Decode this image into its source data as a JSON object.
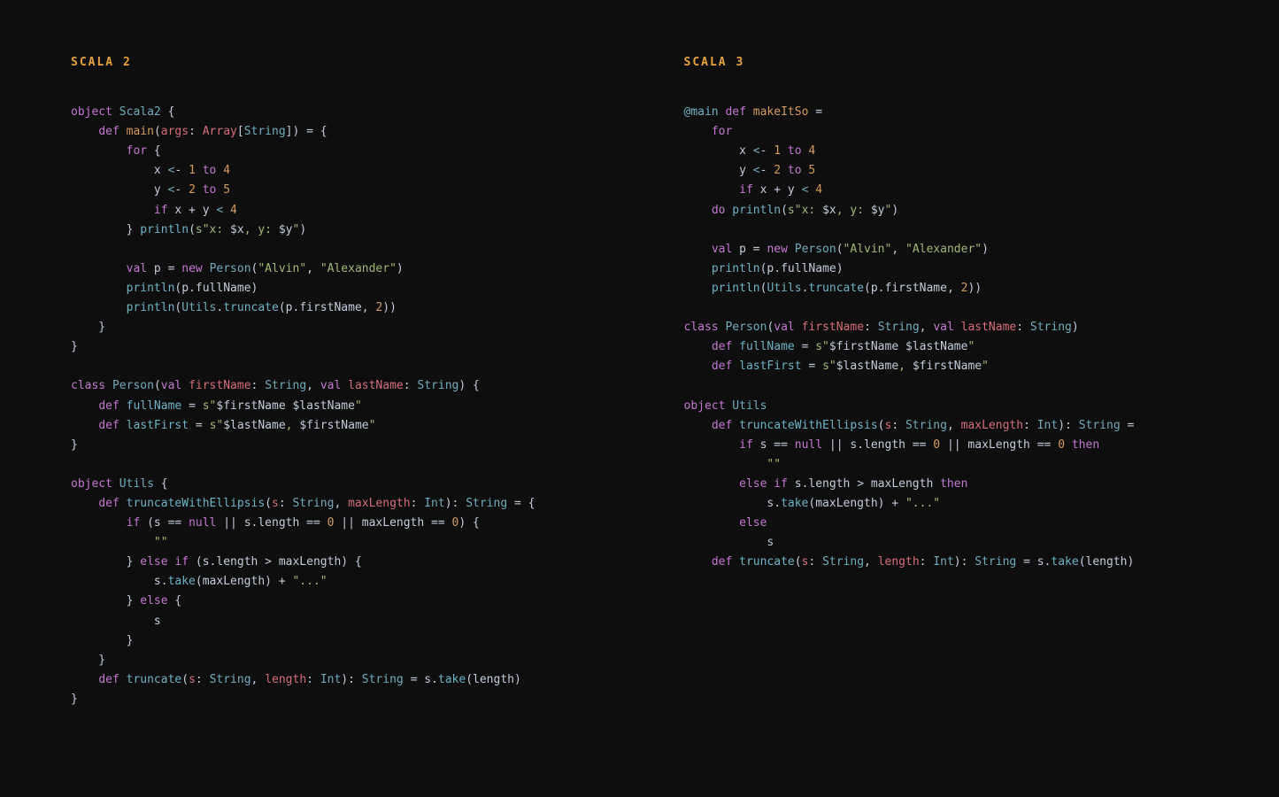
{
  "left": {
    "title": "SCALA 2",
    "lines": [
      [
        [
          "kw",
          "object"
        ],
        [
          "pl",
          " "
        ],
        [
          "ty",
          "Scala2"
        ],
        [
          "pl",
          " {"
        ]
      ],
      [
        [
          "pl",
          "    "
        ],
        [
          "kw",
          "def"
        ],
        [
          "pl",
          " "
        ],
        [
          "name",
          "main"
        ],
        [
          "pl",
          "("
        ],
        [
          "id",
          "args"
        ],
        [
          "pl",
          ": "
        ],
        [
          "id",
          "Array"
        ],
        [
          "pl",
          "["
        ],
        [
          "ty",
          "String"
        ],
        [
          "pl",
          "]) = {"
        ]
      ],
      [
        [
          "pl",
          "        "
        ],
        [
          "kw",
          "for"
        ],
        [
          "pl",
          " {"
        ]
      ],
      [
        [
          "pl",
          "            x "
        ],
        [
          "op",
          "<"
        ],
        [
          "pl",
          "- "
        ],
        [
          "num",
          "1"
        ],
        [
          "pl",
          " "
        ],
        [
          "kw",
          "to"
        ],
        [
          "pl",
          " "
        ],
        [
          "num",
          "4"
        ]
      ],
      [
        [
          "pl",
          "            y "
        ],
        [
          "op",
          "<"
        ],
        [
          "pl",
          "- "
        ],
        [
          "num",
          "2"
        ],
        [
          "pl",
          " "
        ],
        [
          "kw",
          "to"
        ],
        [
          "pl",
          " "
        ],
        [
          "num",
          "5"
        ]
      ],
      [
        [
          "pl",
          "            "
        ],
        [
          "kw",
          "if"
        ],
        [
          "pl",
          " x + y "
        ],
        [
          "op",
          "<"
        ],
        [
          "pl",
          " "
        ],
        [
          "num",
          "4"
        ]
      ],
      [
        [
          "pl",
          "        } "
        ],
        [
          "fn",
          "println"
        ],
        [
          "pl",
          "("
        ],
        [
          "str",
          "s\"x: "
        ],
        [
          "pl",
          "$x"
        ],
        [
          "str",
          ", y: "
        ],
        [
          "pl",
          "$y"
        ],
        [
          "str",
          "\""
        ],
        [
          "pl",
          ")"
        ]
      ],
      [
        [
          "pl",
          ""
        ]
      ],
      [
        [
          "pl",
          "        "
        ],
        [
          "kw",
          "val"
        ],
        [
          "pl",
          " p = "
        ],
        [
          "kw",
          "new"
        ],
        [
          "pl",
          " "
        ],
        [
          "ty",
          "Person"
        ],
        [
          "pl",
          "("
        ],
        [
          "str",
          "\"Alvin\""
        ],
        [
          "pl",
          ", "
        ],
        [
          "str",
          "\"Alexander\""
        ],
        [
          "pl",
          ")"
        ]
      ],
      [
        [
          "pl",
          "        "
        ],
        [
          "fn",
          "println"
        ],
        [
          "pl",
          "(p.fullName)"
        ]
      ],
      [
        [
          "pl",
          "        "
        ],
        [
          "fn",
          "println"
        ],
        [
          "pl",
          "("
        ],
        [
          "ty",
          "Utils"
        ],
        [
          "pl",
          "."
        ],
        [
          "fn",
          "truncate"
        ],
        [
          "pl",
          "(p.firstName, "
        ],
        [
          "num",
          "2"
        ],
        [
          "pl",
          "))"
        ]
      ],
      [
        [
          "pl",
          "    }"
        ]
      ],
      [
        [
          "pl",
          "}"
        ]
      ],
      [
        [
          "pl",
          ""
        ]
      ],
      [
        [
          "kw",
          "class"
        ],
        [
          "pl",
          " "
        ],
        [
          "ty",
          "Person"
        ],
        [
          "pl",
          "("
        ],
        [
          "kw",
          "val"
        ],
        [
          "pl",
          " "
        ],
        [
          "id",
          "firstName"
        ],
        [
          "pl",
          ": "
        ],
        [
          "ty",
          "String"
        ],
        [
          "pl",
          ", "
        ],
        [
          "kw",
          "val"
        ],
        [
          "pl",
          " "
        ],
        [
          "id",
          "lastName"
        ],
        [
          "pl",
          ": "
        ],
        [
          "ty",
          "String"
        ],
        [
          "pl",
          ") {"
        ]
      ],
      [
        [
          "pl",
          "    "
        ],
        [
          "kw",
          "def"
        ],
        [
          "pl",
          " "
        ],
        [
          "fn",
          "fullName"
        ],
        [
          "pl",
          " = "
        ],
        [
          "str",
          "s\""
        ],
        [
          "pl",
          "$firstName $lastName"
        ],
        [
          "str",
          "\""
        ]
      ],
      [
        [
          "pl",
          "    "
        ],
        [
          "kw",
          "def"
        ],
        [
          "pl",
          " "
        ],
        [
          "fn",
          "lastFirst"
        ],
        [
          "pl",
          " = "
        ],
        [
          "str",
          "s\""
        ],
        [
          "pl",
          "$lastName"
        ],
        [
          "str",
          ", "
        ],
        [
          "pl",
          "$firstName"
        ],
        [
          "str",
          "\""
        ]
      ],
      [
        [
          "pl",
          "}"
        ]
      ],
      [
        [
          "pl",
          ""
        ]
      ],
      [
        [
          "kw",
          "object"
        ],
        [
          "pl",
          " "
        ],
        [
          "ty",
          "Utils"
        ],
        [
          "pl",
          " {"
        ]
      ],
      [
        [
          "pl",
          "    "
        ],
        [
          "kw",
          "def"
        ],
        [
          "pl",
          " "
        ],
        [
          "fn",
          "truncateWithEllipsis"
        ],
        [
          "pl",
          "("
        ],
        [
          "id",
          "s"
        ],
        [
          "pl",
          ": "
        ],
        [
          "ty",
          "String"
        ],
        [
          "pl",
          ", "
        ],
        [
          "id",
          "maxLength"
        ],
        [
          "pl",
          ": "
        ],
        [
          "ty",
          "Int"
        ],
        [
          "pl",
          "): "
        ],
        [
          "ty",
          "String"
        ],
        [
          "pl",
          " = {"
        ]
      ],
      [
        [
          "pl",
          "        "
        ],
        [
          "kw",
          "if"
        ],
        [
          "pl",
          " (s == "
        ],
        [
          "kw",
          "null"
        ],
        [
          "pl",
          " || s.length == "
        ],
        [
          "num",
          "0"
        ],
        [
          "pl",
          " || maxLength == "
        ],
        [
          "num",
          "0"
        ],
        [
          "pl",
          ") {"
        ]
      ],
      [
        [
          "pl",
          "            "
        ],
        [
          "str",
          "\"\""
        ]
      ],
      [
        [
          "pl",
          "        } "
        ],
        [
          "kw",
          "else"
        ],
        [
          "pl",
          " "
        ],
        [
          "kw",
          "if"
        ],
        [
          "pl",
          " (s.length > maxLength) {"
        ]
      ],
      [
        [
          "pl",
          "            s."
        ],
        [
          "fn",
          "take"
        ],
        [
          "pl",
          "(maxLength) + "
        ],
        [
          "str",
          "\"...\""
        ]
      ],
      [
        [
          "pl",
          "        } "
        ],
        [
          "kw",
          "else"
        ],
        [
          "pl",
          " {"
        ]
      ],
      [
        [
          "pl",
          "            s"
        ]
      ],
      [
        [
          "pl",
          "        }"
        ]
      ],
      [
        [
          "pl",
          "    }"
        ]
      ],
      [
        [
          "pl",
          "    "
        ],
        [
          "kw",
          "def"
        ],
        [
          "pl",
          " "
        ],
        [
          "fn",
          "truncate"
        ],
        [
          "pl",
          "("
        ],
        [
          "id",
          "s"
        ],
        [
          "pl",
          ": "
        ],
        [
          "ty",
          "String"
        ],
        [
          "pl",
          ", "
        ],
        [
          "id",
          "length"
        ],
        [
          "pl",
          ": "
        ],
        [
          "ty",
          "Int"
        ],
        [
          "pl",
          "): "
        ],
        [
          "ty",
          "String"
        ],
        [
          "pl",
          " = s."
        ],
        [
          "fn",
          "take"
        ],
        [
          "pl",
          "(length)"
        ]
      ],
      [
        [
          "pl",
          "}"
        ]
      ]
    ]
  },
  "right": {
    "title": "SCALA 3",
    "lines": [
      [
        [
          "fn",
          "@main"
        ],
        [
          "pl",
          " "
        ],
        [
          "kw",
          "def"
        ],
        [
          "pl",
          " "
        ],
        [
          "name",
          "makeItSo"
        ],
        [
          "pl",
          " ="
        ]
      ],
      [
        [
          "pl",
          "    "
        ],
        [
          "kw",
          "for"
        ]
      ],
      [
        [
          "pl",
          "        x "
        ],
        [
          "op",
          "<"
        ],
        [
          "pl",
          "- "
        ],
        [
          "num",
          "1"
        ],
        [
          "pl",
          " "
        ],
        [
          "kw",
          "to"
        ],
        [
          "pl",
          " "
        ],
        [
          "num",
          "4"
        ]
      ],
      [
        [
          "pl",
          "        y "
        ],
        [
          "op",
          "<"
        ],
        [
          "pl",
          "- "
        ],
        [
          "num",
          "2"
        ],
        [
          "pl",
          " "
        ],
        [
          "kw",
          "to"
        ],
        [
          "pl",
          " "
        ],
        [
          "num",
          "5"
        ]
      ],
      [
        [
          "pl",
          "        "
        ],
        [
          "kw",
          "if"
        ],
        [
          "pl",
          " x + y "
        ],
        [
          "op",
          "<"
        ],
        [
          "pl",
          " "
        ],
        [
          "num",
          "4"
        ]
      ],
      [
        [
          "pl",
          "    "
        ],
        [
          "kw",
          "do"
        ],
        [
          "pl",
          " "
        ],
        [
          "fn",
          "println"
        ],
        [
          "pl",
          "("
        ],
        [
          "str",
          "s\"x: "
        ],
        [
          "pl",
          "$x"
        ],
        [
          "str",
          ", y: "
        ],
        [
          "pl",
          "$y"
        ],
        [
          "str",
          "\""
        ],
        [
          "pl",
          ")"
        ]
      ],
      [
        [
          "pl",
          ""
        ]
      ],
      [
        [
          "pl",
          "    "
        ],
        [
          "kw",
          "val"
        ],
        [
          "pl",
          " p = "
        ],
        [
          "kw",
          "new"
        ],
        [
          "pl",
          " "
        ],
        [
          "ty",
          "Person"
        ],
        [
          "pl",
          "("
        ],
        [
          "str",
          "\"Alvin\""
        ],
        [
          "pl",
          ", "
        ],
        [
          "str",
          "\"Alexander\""
        ],
        [
          "pl",
          ")"
        ]
      ],
      [
        [
          "pl",
          "    "
        ],
        [
          "fn",
          "println"
        ],
        [
          "pl",
          "(p.fullName)"
        ]
      ],
      [
        [
          "pl",
          "    "
        ],
        [
          "fn",
          "println"
        ],
        [
          "pl",
          "("
        ],
        [
          "ty",
          "Utils"
        ],
        [
          "pl",
          "."
        ],
        [
          "fn",
          "truncate"
        ],
        [
          "pl",
          "(p.firstName, "
        ],
        [
          "num",
          "2"
        ],
        [
          "pl",
          "))"
        ]
      ],
      [
        [
          "pl",
          ""
        ]
      ],
      [
        [
          "kw",
          "class"
        ],
        [
          "pl",
          " "
        ],
        [
          "ty",
          "Person"
        ],
        [
          "pl",
          "("
        ],
        [
          "kw",
          "val"
        ],
        [
          "pl",
          " "
        ],
        [
          "id",
          "firstName"
        ],
        [
          "pl",
          ": "
        ],
        [
          "ty",
          "String"
        ],
        [
          "pl",
          ", "
        ],
        [
          "kw",
          "val"
        ],
        [
          "pl",
          " "
        ],
        [
          "id",
          "lastName"
        ],
        [
          "pl",
          ": "
        ],
        [
          "ty",
          "String"
        ],
        [
          "pl",
          ")"
        ]
      ],
      [
        [
          "pl",
          "    "
        ],
        [
          "kw",
          "def"
        ],
        [
          "pl",
          " "
        ],
        [
          "fn",
          "fullName"
        ],
        [
          "pl",
          " = "
        ],
        [
          "str",
          "s\""
        ],
        [
          "pl",
          "$firstName $lastName"
        ],
        [
          "str",
          "\""
        ]
      ],
      [
        [
          "pl",
          "    "
        ],
        [
          "kw",
          "def"
        ],
        [
          "pl",
          " "
        ],
        [
          "fn",
          "lastFirst"
        ],
        [
          "pl",
          " = "
        ],
        [
          "str",
          "s\""
        ],
        [
          "pl",
          "$lastName"
        ],
        [
          "str",
          ", "
        ],
        [
          "pl",
          "$firstName"
        ],
        [
          "str",
          "\""
        ]
      ],
      [
        [
          "pl",
          ""
        ]
      ],
      [
        [
          "kw",
          "object"
        ],
        [
          "pl",
          " "
        ],
        [
          "ty",
          "Utils"
        ]
      ],
      [
        [
          "pl",
          "    "
        ],
        [
          "kw",
          "def"
        ],
        [
          "pl",
          " "
        ],
        [
          "fn",
          "truncateWithEllipsis"
        ],
        [
          "pl",
          "("
        ],
        [
          "id",
          "s"
        ],
        [
          "pl",
          ": "
        ],
        [
          "ty",
          "String"
        ],
        [
          "pl",
          ", "
        ],
        [
          "id",
          "maxLength"
        ],
        [
          "pl",
          ": "
        ],
        [
          "ty",
          "Int"
        ],
        [
          "pl",
          "): "
        ],
        [
          "ty",
          "String"
        ],
        [
          "pl",
          " ="
        ]
      ],
      [
        [
          "pl",
          "        "
        ],
        [
          "kw",
          "if"
        ],
        [
          "pl",
          " s == "
        ],
        [
          "kw",
          "null"
        ],
        [
          "pl",
          " || s.length == "
        ],
        [
          "num",
          "0"
        ],
        [
          "pl",
          " || maxLength == "
        ],
        [
          "num",
          "0"
        ],
        [
          "pl",
          " "
        ],
        [
          "kw",
          "then"
        ]
      ],
      [
        [
          "pl",
          "            "
        ],
        [
          "str",
          "\"\""
        ]
      ],
      [
        [
          "pl",
          "        "
        ],
        [
          "kw",
          "else"
        ],
        [
          "pl",
          " "
        ],
        [
          "kw",
          "if"
        ],
        [
          "pl",
          " s.length > maxLength "
        ],
        [
          "kw",
          "then"
        ]
      ],
      [
        [
          "pl",
          "            s."
        ],
        [
          "fn",
          "take"
        ],
        [
          "pl",
          "(maxLength) + "
        ],
        [
          "str",
          "\"...\""
        ]
      ],
      [
        [
          "pl",
          "        "
        ],
        [
          "kw",
          "else"
        ]
      ],
      [
        [
          "pl",
          "            s"
        ]
      ],
      [
        [
          "pl",
          "    "
        ],
        [
          "kw",
          "def"
        ],
        [
          "pl",
          " "
        ],
        [
          "fn",
          "truncate"
        ],
        [
          "pl",
          "("
        ],
        [
          "id",
          "s"
        ],
        [
          "pl",
          ": "
        ],
        [
          "ty",
          "String"
        ],
        [
          "pl",
          ", "
        ],
        [
          "id",
          "length"
        ],
        [
          "pl",
          ": "
        ],
        [
          "ty",
          "Int"
        ],
        [
          "pl",
          "): "
        ],
        [
          "ty",
          "String"
        ],
        [
          "pl",
          " = s."
        ],
        [
          "fn",
          "take"
        ],
        [
          "pl",
          "(length)"
        ]
      ]
    ]
  }
}
